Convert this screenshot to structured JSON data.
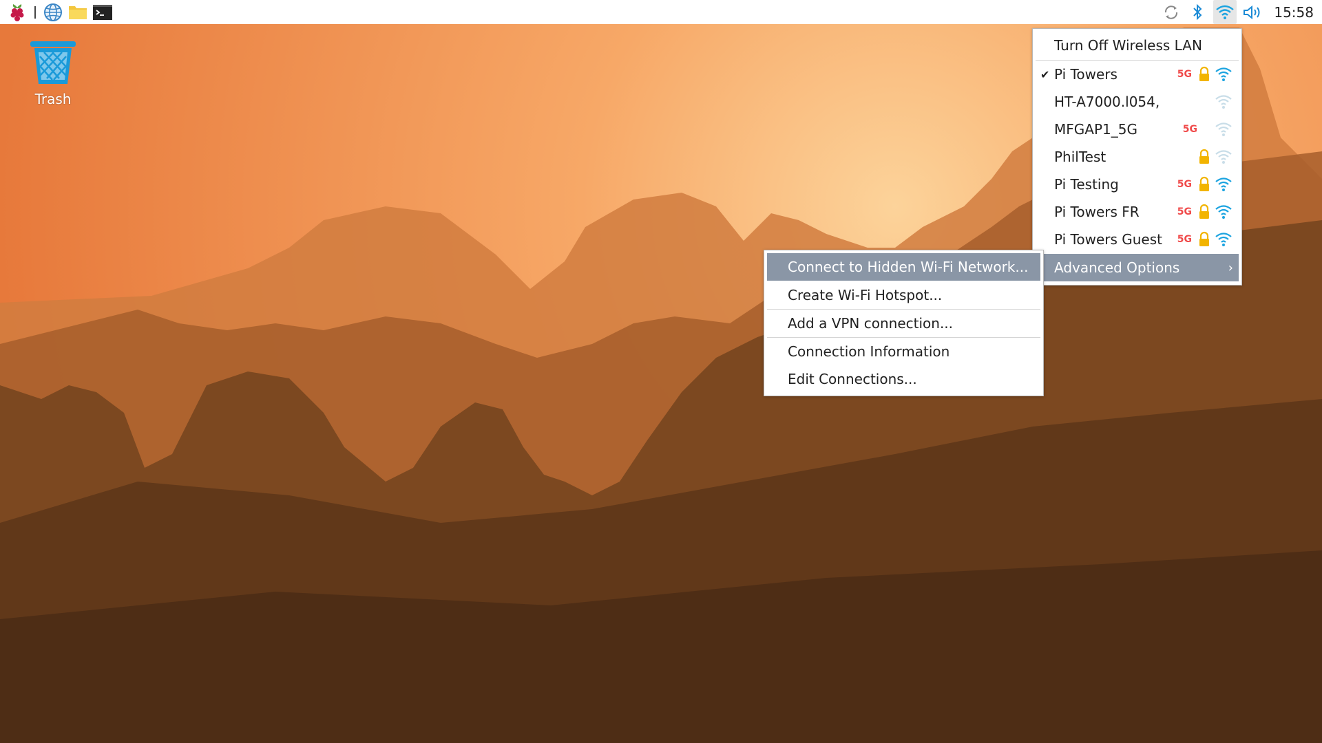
{
  "taskbar": {
    "launchers": [
      {
        "icon": "raspberry-pi-menu-icon"
      },
      {
        "icon": "web-browser-icon"
      },
      {
        "icon": "file-manager-icon"
      },
      {
        "icon": "terminal-icon"
      }
    ],
    "tray": [
      {
        "icon": "update-sync-icon"
      },
      {
        "icon": "bluetooth-icon"
      },
      {
        "icon": "wifi-icon"
      },
      {
        "icon": "volume-icon"
      }
    ],
    "clock": "15:58"
  },
  "desktop": {
    "trash_label": "Trash"
  },
  "wifi_menu": {
    "turn_off": "Turn Off Wireless LAN",
    "networks": [
      {
        "name": "Pi Towers",
        "connected": true,
        "band": "5G",
        "secured": true,
        "signal": "strong"
      },
      {
        "name": "HT-A7000.l054,",
        "connected": false,
        "band": "",
        "secured": false,
        "signal": "weak"
      },
      {
        "name": "MFGAP1_5G",
        "connected": false,
        "band": "5G",
        "secured": false,
        "signal": "weak"
      },
      {
        "name": "PhilTest",
        "connected": false,
        "band": "",
        "secured": true,
        "signal": "weak"
      },
      {
        "name": "Pi Testing",
        "connected": false,
        "band": "5G",
        "secured": true,
        "signal": "strong"
      },
      {
        "name": "Pi Towers FR",
        "connected": false,
        "band": "5G",
        "secured": true,
        "signal": "strong"
      },
      {
        "name": "Pi Towers Guest",
        "connected": false,
        "band": "5G",
        "secured": true,
        "signal": "strong"
      }
    ],
    "advanced": "Advanced Options",
    "check_mark": "✔",
    "submenu_arrow": "›"
  },
  "advanced_menu": {
    "items": [
      "Connect to Hidden Wi-Fi Network...",
      "Create Wi-Fi Hotspot...",
      "Add a VPN connection...",
      "Connection Information",
      "Edit Connections..."
    ]
  },
  "colors": {
    "menu_highlight": "#8a96a6",
    "badge_5g": "#f04a4a",
    "wifi_strong": "#1aa3e0",
    "wifi_weak": "#c8dde8",
    "lock": "#f2b400"
  }
}
